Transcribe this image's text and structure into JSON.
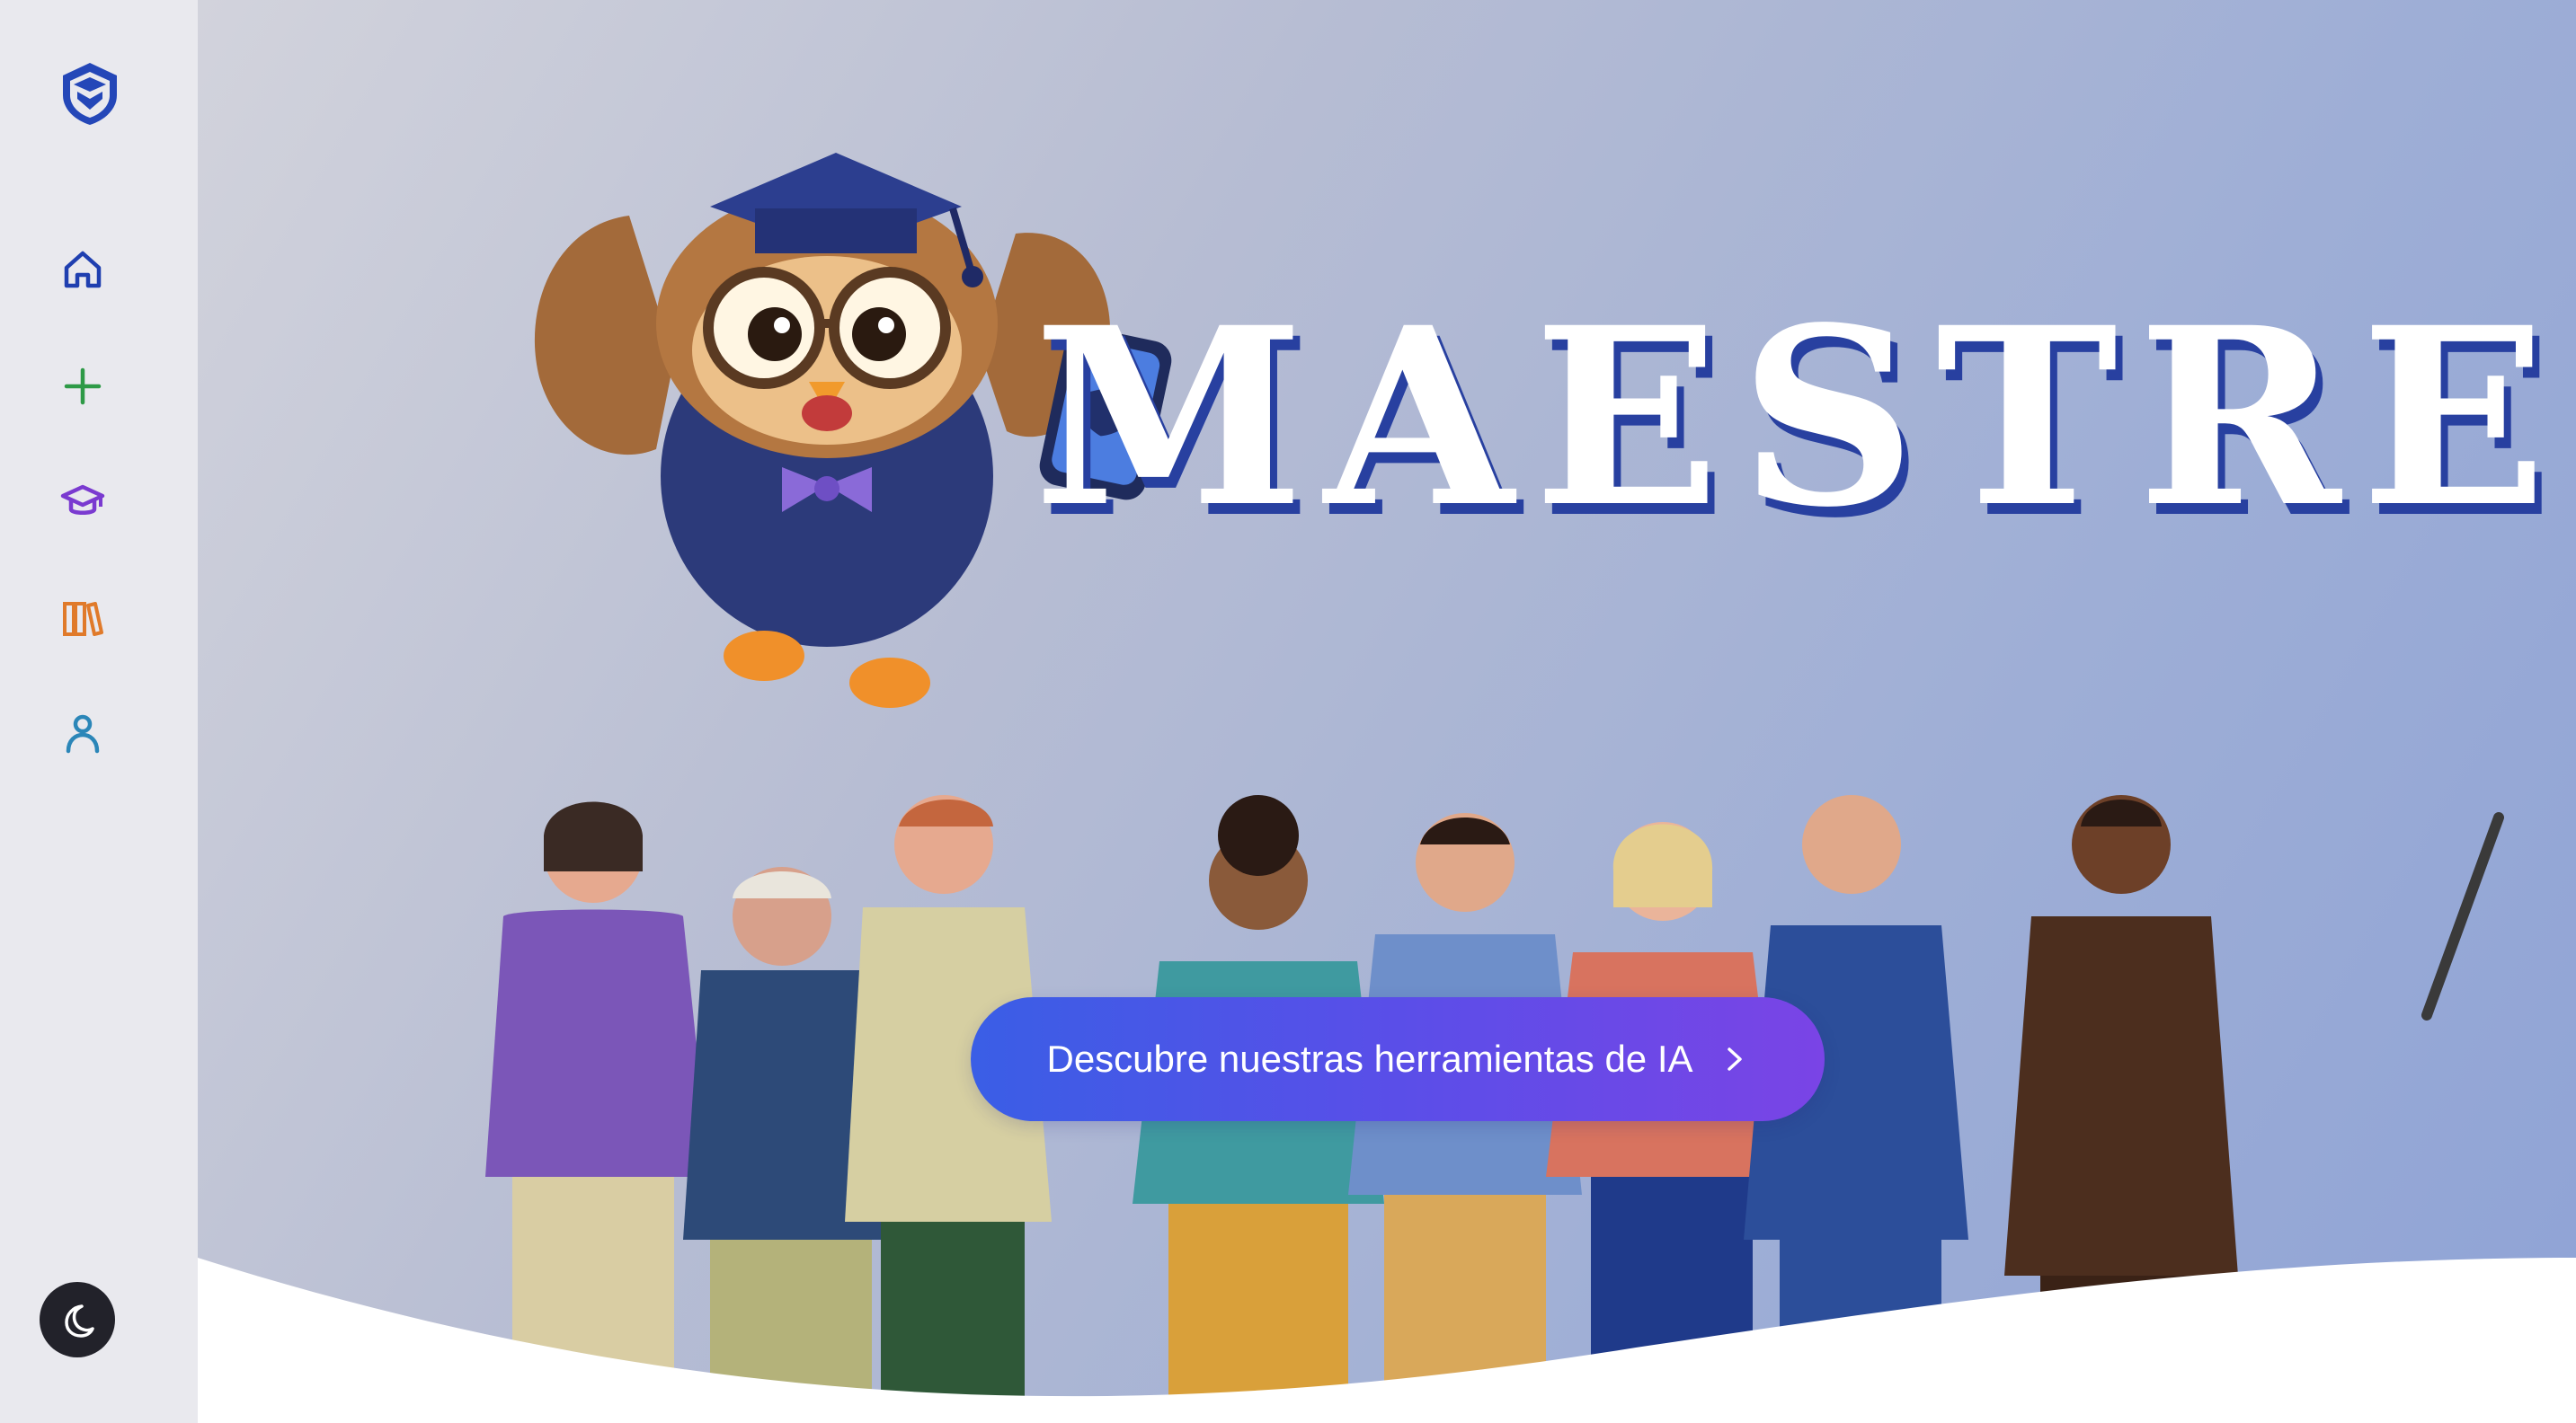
{
  "brand": {
    "title": "MAESTRE"
  },
  "hero": {
    "cta_label": "Descubre nuestras herramientas de IA"
  },
  "sidebar": {
    "items": [
      {
        "name": "home",
        "icon": "home-icon",
        "color": "#1f3fb0"
      },
      {
        "name": "create",
        "icon": "plus-icon",
        "color": "#2e9a47"
      },
      {
        "name": "courses",
        "icon": "graduation-cap-icon",
        "color": "#7a3ad0"
      },
      {
        "name": "library",
        "icon": "books-icon",
        "color": "#e07a2a"
      },
      {
        "name": "profile",
        "icon": "user-icon",
        "color": "#2b86b8"
      }
    ],
    "theme_toggle_icon": "moon-icon"
  },
  "colors": {
    "accent_blue": "#3a5ee6",
    "accent_purple": "#7a44e6",
    "brand_shadow": "#2840a0"
  }
}
